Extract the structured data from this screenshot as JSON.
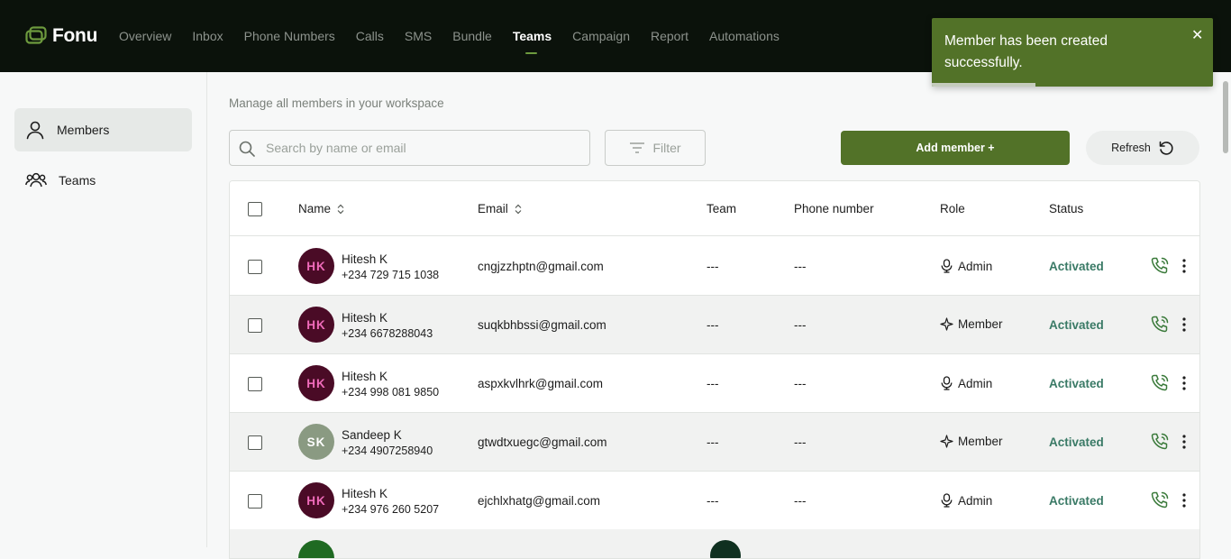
{
  "app": {
    "name": "Fonu",
    "nav": [
      "Overview",
      "Inbox",
      "Phone Numbers",
      "Calls",
      "SMS",
      "Bundle",
      "Teams",
      "Campaign",
      "Report",
      "Automations"
    ],
    "active_nav": "Teams"
  },
  "sidebar": {
    "items": [
      {
        "label": "Members",
        "icon": "user-icon",
        "active": true
      },
      {
        "label": "Teams",
        "icon": "users-icon",
        "active": false
      }
    ]
  },
  "main": {
    "subtitle": "Manage all members in your workspace",
    "search_placeholder": "Search by name or email",
    "filter_label": "Filter",
    "add_label": "Add member +",
    "refresh_label": "Refresh"
  },
  "table": {
    "headers": {
      "name": "Name",
      "email": "Email",
      "team": "Team",
      "phone": "Phone number",
      "role": "Role",
      "status": "Status"
    },
    "rows": [
      {
        "initials": "HK",
        "name": "Hitesh K",
        "phone": "+234 729 715 1038",
        "email": "cngjzzhptn@gmail.com",
        "team": "---",
        "phone_number": "---",
        "role": "Admin",
        "role_icon": "mic-icon",
        "status": "Activated",
        "avatar_bg": "#4a0b26",
        "avatar_fg": "#f06bbb"
      },
      {
        "initials": "HK",
        "name": "Hitesh K",
        "phone": "+234 6678288043",
        "email": "suqkbhbssi@gmail.com",
        "team": "---",
        "phone_number": "---",
        "role": "Member",
        "role_icon": "sparkle-icon",
        "status": "Activated",
        "avatar_bg": "#4a0b26",
        "avatar_fg": "#f06bbb"
      },
      {
        "initials": "HK",
        "name": "Hitesh K",
        "phone": "+234 998 081 9850",
        "email": "aspxkvlhrk@gmail.com",
        "team": "---",
        "phone_number": "---",
        "role": "Admin",
        "role_icon": "mic-icon",
        "status": "Activated",
        "avatar_bg": "#4a0b26",
        "avatar_fg": "#f06bbb"
      },
      {
        "initials": "SK",
        "name": "Sandeep K",
        "phone": "+234 4907258940",
        "email": "gtwdtxuegc@gmail.com",
        "team": "---",
        "phone_number": "---",
        "role": "Member",
        "role_icon": "sparkle-icon",
        "status": "Activated",
        "avatar_bg": "#8a9a82",
        "avatar_fg": "#ffffff"
      },
      {
        "initials": "HK",
        "name": "Hitesh K",
        "phone": "+234 976 260 5207",
        "email": "ejchlxhatg@gmail.com",
        "team": "---",
        "phone_number": "---",
        "role": "Admin",
        "role_icon": "mic-icon",
        "status": "Activated",
        "avatar_bg": "#4a0b26",
        "avatar_fg": "#f06bbb"
      }
    ]
  },
  "toast": {
    "message": "Member has been created successfully.",
    "progress": 0.37
  },
  "colors": {
    "brand": "#527228",
    "status_activated": "#3a7a66",
    "topbar": "#0b120b"
  }
}
